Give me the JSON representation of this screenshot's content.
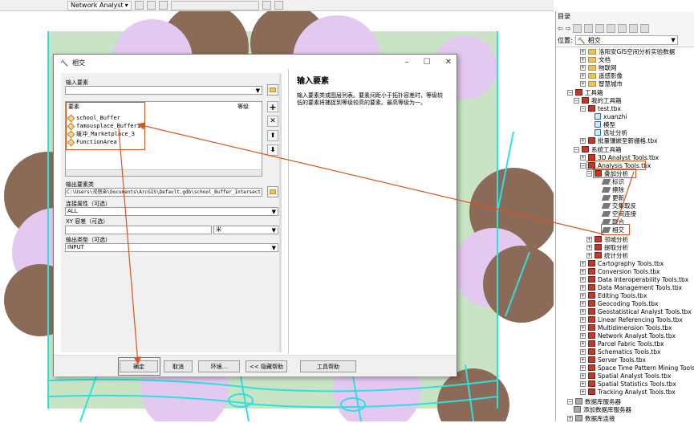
{
  "toolbar": {
    "network_analyst_label": "Network Analyst"
  },
  "dialog": {
    "title": "相交",
    "input_features_label": "输入要素",
    "features_header": "要素",
    "rank_header": "等级",
    "features": [
      "school_Buffer",
      "famousplace_Buffer1",
      "缓冲_Marketplace_3",
      "FunctionArea"
    ],
    "output_label": "输出要素类",
    "output_value": "C:\\Users\\戎悠亲\\Documents\\ArcGIS\\Default.gdb\\school_Buffer_Intersect",
    "join_label": "连接属性（可选）",
    "join_value": "ALL",
    "xy_label": "XY 容差（可选）",
    "xy_value": "",
    "xy_unit": "米",
    "outtype_label": "输出类型（可选）",
    "outtype_value": "INPUT",
    "help_title": "输入要素",
    "help_text": "输入要素类或图层列表。要素间距小于拓扑容差时，等级较低的要素将捕捉到等级较高的要素。最高等级为一。",
    "buttons": {
      "ok": "确定",
      "cancel": "取消",
      "env": "环境...",
      "hide_help": "<< 隐藏帮助",
      "tool_help": "工具帮助"
    }
  },
  "catalog": {
    "title": "目录",
    "location_label": "位置:",
    "location_value": "相交",
    "tree": [
      "洛阳安GIS空间分析实验数据",
      "文档",
      "物联网",
      "遥感影像",
      "智慧城市",
      "工具箱",
      "我的工具箱",
      "test.tbx",
      "xuanzhi",
      "模型",
      "选址分析",
      "批量镶嵌至新栅格.tbx",
      "系统工具箱",
      "3D Analyst Tools.tbx",
      "Analysis Tools.tbx",
      "叠加分析",
      "标识",
      "擦除",
      "更新",
      "交集取反",
      "空间连接",
      "联合",
      "相交",
      "邻域分析",
      "提取分析",
      "统计分析",
      "Cartography Tools.tbx",
      "Conversion Tools.tbx",
      "Data Interoperability Tools.tbx",
      "Data Management Tools.tbx",
      "Editing Tools.tbx",
      "Geocoding Tools.tbx",
      "Geostatistical Analyst Tools.tbx",
      "Linear Referencing Tools.tbx",
      "Multidimension Tools.tbx",
      "Network Analyst Tools.tbx",
      "Parcel Fabric Tools.tbx",
      "Schematics Tools.tbx",
      "Server Tools.tbx",
      "Space Time Pattern Mining Tools.",
      "Spatial Analyst Tools.tbx",
      "Spatial Statistics Tools.tbx",
      "Tracking Analyst Tools.tbx",
      "数据库服务器",
      "添加数据库服务器",
      "数据库连接"
    ]
  },
  "colors": {
    "accent_red": "#d9531e",
    "buffer_brown": "#8b6b57",
    "buffer_purple": "#e3c8ef",
    "roads": "#2ee0e0",
    "green": "#c9e4c5"
  }
}
